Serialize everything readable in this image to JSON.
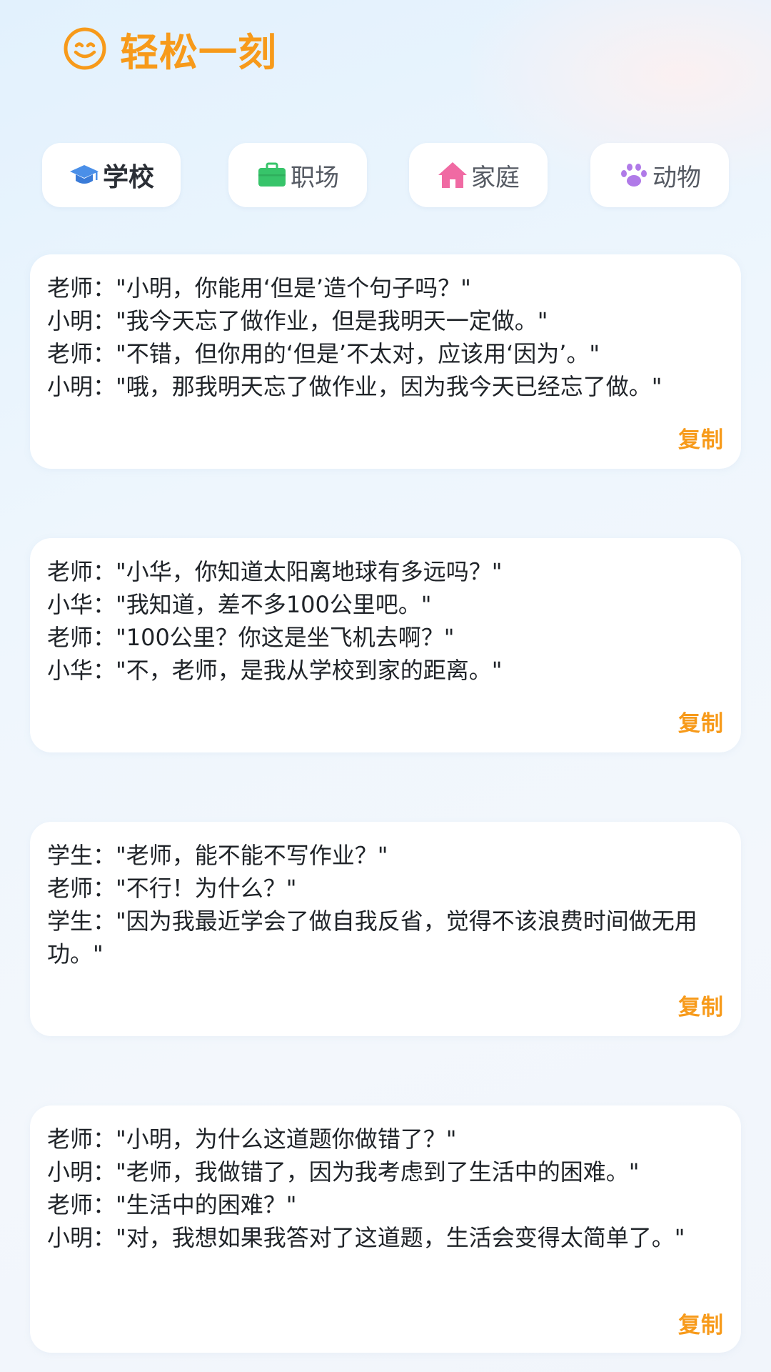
{
  "app": {
    "title": "轻松一刻",
    "accent": "#f79a1a"
  },
  "tabs": [
    {
      "label": "学校",
      "icon": "graduation-cap-icon",
      "icon_color": "#4a8fe8",
      "active": true
    },
    {
      "label": "职场",
      "icon": "briefcase-icon",
      "icon_color": "#37c46a",
      "active": false
    },
    {
      "label": "家庭",
      "icon": "house-icon",
      "icon_color": "#f06aa3",
      "active": false
    },
    {
      "label": "动物",
      "icon": "paw-icon",
      "icon_color": "#b07ae8",
      "active": false
    }
  ],
  "jokes": [
    {
      "lines": [
        "老师：\"小明，你能用‘但是’造个句子吗？\"",
        "小明：\"我今天忘了做作业，但是我明天一定做。\"",
        "老师：\"不错，但你用的‘但是’不太对，应该用‘因为’。\"",
        "小明：\"哦，那我明天忘了做作业，因为我今天已经忘了做。\""
      ],
      "copy_label": "复制"
    },
    {
      "lines": [
        "老师：\"小华，你知道太阳离地球有多远吗？\"",
        "小华：\"我知道，差不多100公里吧。\"",
        "老师：\"100公里？你这是坐飞机去啊？\"",
        "小华：\"不，老师，是我从学校到家的距离。\""
      ],
      "copy_label": "复制"
    },
    {
      "lines": [
        "学生：\"老师，能不能不写作业？\"",
        "老师：\"不行！为什么？\"",
        "学生：\"因为我最近学会了做自我反省，觉得不该浪费时间做无用功。\""
      ],
      "copy_label": "复制"
    },
    {
      "lines": [
        "老师：\"小明，为什么这道题你做错了？\"",
        "小明：\"老师，我做错了，因为我考虑到了生活中的困难。\"",
        "老师：\"生活中的困难？\"",
        "小明：\"对，我想如果我答对了这道题，生活会变得太简单了。\""
      ],
      "copy_label": "复制"
    }
  ]
}
